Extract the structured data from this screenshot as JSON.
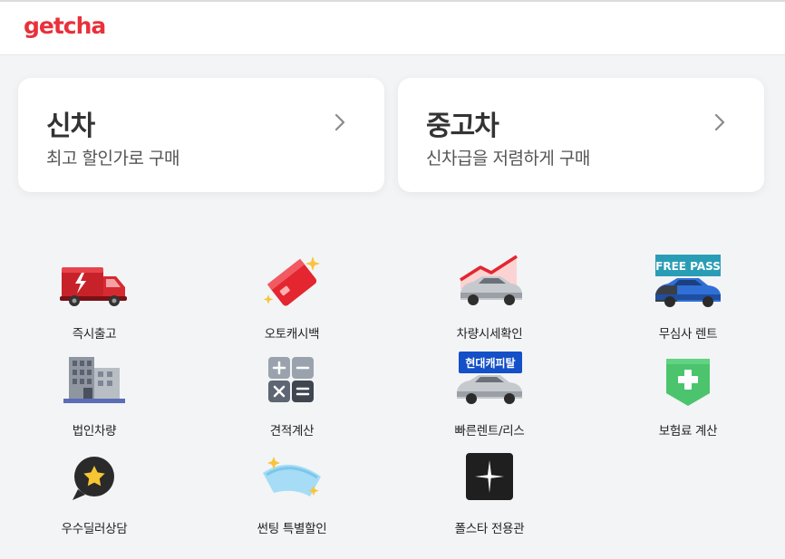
{
  "header": {
    "logo": "getcha"
  },
  "cards": [
    {
      "title": "신차",
      "subtitle": "최고 할인가로 구매"
    },
    {
      "title": "중고차",
      "subtitle": "신차급을 저렴하게 구매"
    }
  ],
  "services": [
    {
      "label": "즉시출고",
      "icon": "red-truck-icon"
    },
    {
      "label": "오토캐시백",
      "icon": "red-card-sparkle-icon"
    },
    {
      "label": "차량시세확인",
      "icon": "car-price-chart-icon"
    },
    {
      "label": "무심사 렌트",
      "icon": "free-pass-car-icon",
      "badge": "FREE PASS"
    },
    {
      "label": "법인차량",
      "icon": "office-building-icon"
    },
    {
      "label": "견적계산",
      "icon": "calculator-icon"
    },
    {
      "label": "빠른렌트/리스",
      "icon": "hyundai-capital-car-icon",
      "badge": "현대캐피탈"
    },
    {
      "label": "보험료 계산",
      "icon": "insurance-shield-icon"
    },
    {
      "label": "우수딜러상담",
      "icon": "star-chat-icon"
    },
    {
      "label": "썬팅 특별할인",
      "icon": "window-tint-icon"
    },
    {
      "label": "폴스타 전용관",
      "icon": "polestar-icon"
    }
  ],
  "colors": {
    "brand": "#e8313b",
    "background": "#f3f4f6",
    "card": "#ffffff"
  }
}
